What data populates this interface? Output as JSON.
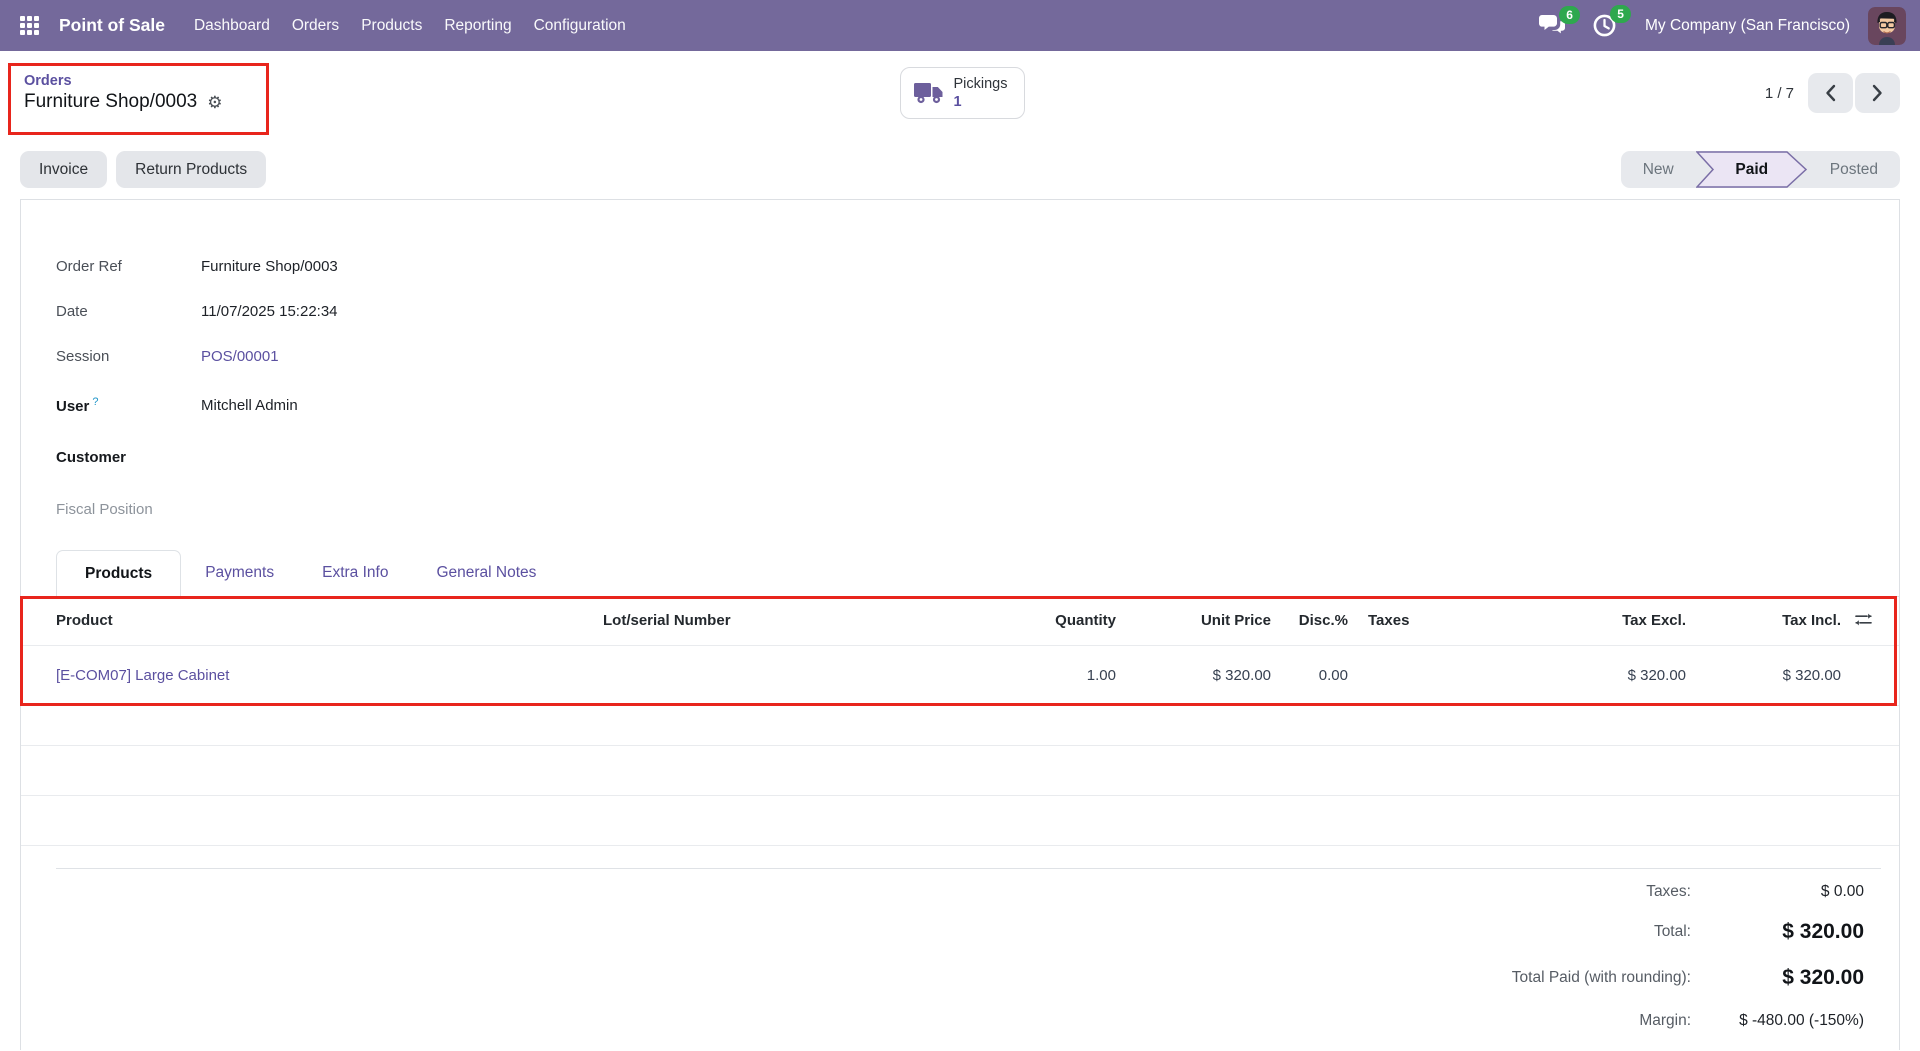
{
  "colors": {
    "navbar-bg": "#74699b",
    "link": "#5b50a0",
    "badge-green": "#2ea84e",
    "annotation-red": "#e8251c",
    "paid-fill": "#ebe5f4",
    "paid-stroke": "#7a6ea6"
  },
  "navbar": {
    "app_name": "Point of Sale",
    "menus": [
      "Dashboard",
      "Orders",
      "Products",
      "Reporting",
      "Configuration"
    ],
    "messages_count": "6",
    "activities_count": "5",
    "company": "My Company (San Francisco)"
  },
  "breadcrumb": {
    "parent": "Orders",
    "current": "Furniture Shop/0003"
  },
  "pickings_button": {
    "label": "Pickings",
    "count": "1"
  },
  "pager": {
    "value": "1 / 7"
  },
  "actions": {
    "invoice": "Invoice",
    "return_products": "Return Products"
  },
  "statusbar": {
    "new": "New",
    "paid": "Paid",
    "posted": "Posted"
  },
  "fields": {
    "order_ref": {
      "label": "Order Ref",
      "value": "Furniture Shop/0003"
    },
    "date": {
      "label": "Date",
      "value": "11/07/2025 15:22:34"
    },
    "session": {
      "label": "Session",
      "value": "POS/00001"
    },
    "user": {
      "label": "User",
      "help": "?",
      "value": "Mitchell Admin"
    },
    "customer": {
      "label": "Customer",
      "value": ""
    },
    "fiscal_position": {
      "label": "Fiscal Position",
      "value": ""
    }
  },
  "tabs": {
    "products": "Products",
    "payments": "Payments",
    "extra_info": "Extra Info",
    "general_notes": "General Notes"
  },
  "table": {
    "headers": {
      "product": "Product",
      "lot": "Lot/serial Number",
      "quantity": "Quantity",
      "unit_price": "Unit Price",
      "discount": "Disc.%",
      "taxes": "Taxes",
      "tax_excl": "Tax Excl.",
      "tax_incl": "Tax Incl."
    },
    "rows": [
      {
        "product": "[E-COM07] Large Cabinet",
        "lot": "",
        "quantity": "1.00",
        "unit_price": "$ 320.00",
        "discount": "0.00",
        "taxes": "",
        "tax_excl": "$ 320.00",
        "tax_incl": "$ 320.00"
      }
    ]
  },
  "totals": {
    "taxes": {
      "label": "Taxes:",
      "value": "$ 0.00"
    },
    "total": {
      "label": "Total:",
      "value": "$ 320.00"
    },
    "total_paid": {
      "label": "Total Paid (with rounding):",
      "value": "$ 320.00"
    },
    "margin": {
      "label": "Margin:",
      "value": "$ -480.00 (-150%)"
    }
  }
}
